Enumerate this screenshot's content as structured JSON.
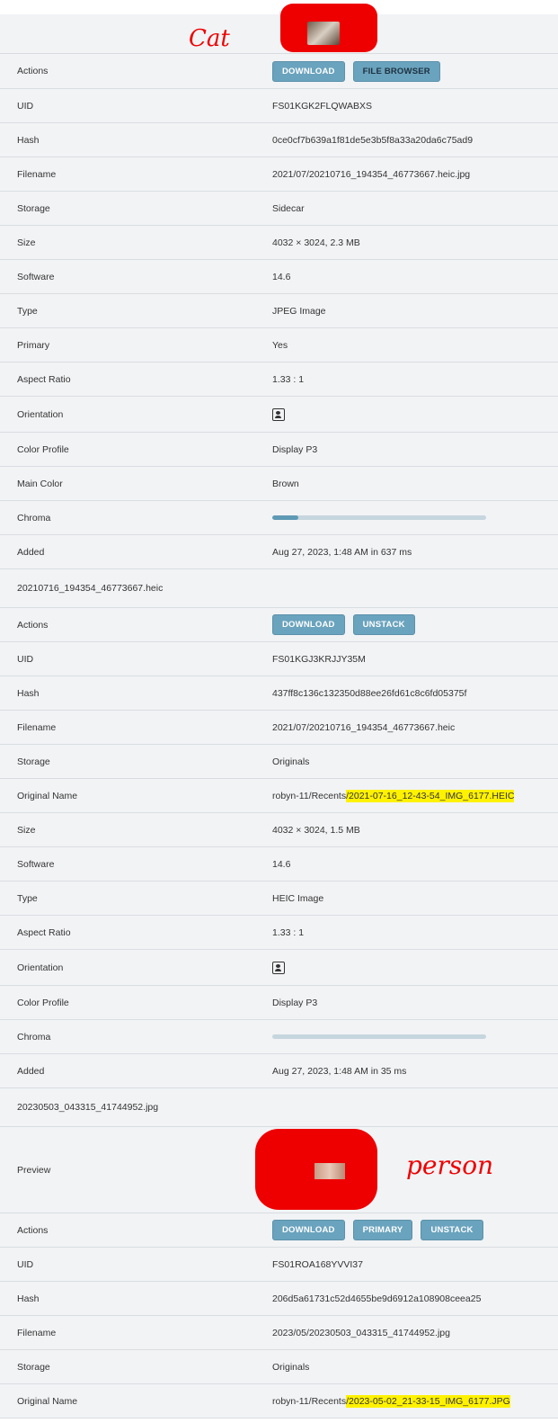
{
  "section1": {
    "annotation": "Cat",
    "rows": {
      "actions": {
        "label": "Actions",
        "buttons": [
          "DOWNLOAD",
          "FILE BROWSER"
        ]
      },
      "uid": {
        "label": "UID",
        "value": "FS01KGK2FLQWABXS"
      },
      "hash": {
        "label": "Hash",
        "value": "0ce0cf7b639a1f81de5e3b5f8a33a20da6c75ad9"
      },
      "filename": {
        "label": "Filename",
        "value": "2021/07/20210716_194354_46773667.heic.jpg"
      },
      "storage": {
        "label": "Storage",
        "value": "Sidecar"
      },
      "size": {
        "label": "Size",
        "value": "4032 × 3024, 2.3 MB"
      },
      "software": {
        "label": "Software",
        "value": "14.6"
      },
      "type": {
        "label": "Type",
        "value": "JPEG Image"
      },
      "primary": {
        "label": "Primary",
        "value": "Yes"
      },
      "aspect": {
        "label": "Aspect Ratio",
        "value": "1.33 : 1"
      },
      "orientation": {
        "label": "Orientation",
        "icon": "portrait-orientation-icon"
      },
      "color_profile": {
        "label": "Color Profile",
        "value": "Display P3"
      },
      "main_color": {
        "label": "Main Color",
        "value": "Brown"
      },
      "chroma": {
        "label": "Chroma",
        "level": 0.12
      },
      "added": {
        "label": "Added",
        "value": "Aug 27, 2023, 1:48 AM in 637 ms"
      }
    }
  },
  "section2": {
    "title": "20210716_194354_46773667.heic",
    "rows": {
      "actions": {
        "label": "Actions",
        "buttons": [
          "DOWNLOAD",
          "UNSTACK"
        ]
      },
      "uid": {
        "label": "UID",
        "value": "FS01KGJ3KRJJY35M"
      },
      "hash": {
        "label": "Hash",
        "value": "437ff8c136c132350d88ee26fd61c8c6fd05375f"
      },
      "filename": {
        "label": "Filename",
        "value": "2021/07/20210716_194354_46773667.heic"
      },
      "storage": {
        "label": "Storage",
        "value": "Originals"
      },
      "original_name": {
        "label": "Original Name",
        "prefix": "robyn-11/Recents",
        "highlight": "/2021-07-16_12-43-54_IMG_6177.HEIC"
      },
      "size": {
        "label": "Size",
        "value": "4032 × 3024, 1.5 MB"
      },
      "software": {
        "label": "Software",
        "value": "14.6"
      },
      "type": {
        "label": "Type",
        "value": "HEIC Image"
      },
      "aspect": {
        "label": "Aspect Ratio",
        "value": "1.33 : 1"
      },
      "orientation": {
        "label": "Orientation",
        "icon": "portrait-orientation-icon"
      },
      "color_profile": {
        "label": "Color Profile",
        "value": "Display P3"
      },
      "chroma": {
        "label": "Chroma",
        "level": 0.0
      },
      "added": {
        "label": "Added",
        "value": "Aug 27, 2023, 1:48 AM in 35 ms"
      }
    }
  },
  "section3": {
    "title": "20230503_043315_41744952.jpg",
    "annotation": "person",
    "rows": {
      "preview": {
        "label": "Preview"
      },
      "actions": {
        "label": "Actions",
        "buttons": [
          "DOWNLOAD",
          "PRIMARY",
          "UNSTACK"
        ]
      },
      "uid": {
        "label": "UID",
        "value": "FS01ROA168YVVI37"
      },
      "hash": {
        "label": "Hash",
        "value": "206d5a61731c52d4655be9d6912a108908ceea25"
      },
      "filename": {
        "label": "Filename",
        "value": "2023/05/20230503_043315_41744952.jpg"
      },
      "storage": {
        "label": "Storage",
        "value": "Originals"
      },
      "original_name": {
        "label": "Original Name",
        "prefix": "robyn-11/Recents",
        "highlight": "/2023-05-02_21-33-15_IMG_6177.JPG"
      }
    }
  },
  "colors": {
    "button": "#6aa3bd",
    "row_bg": "#f2f3f5",
    "highlight": "#fff200",
    "annotation": "#e00000"
  }
}
